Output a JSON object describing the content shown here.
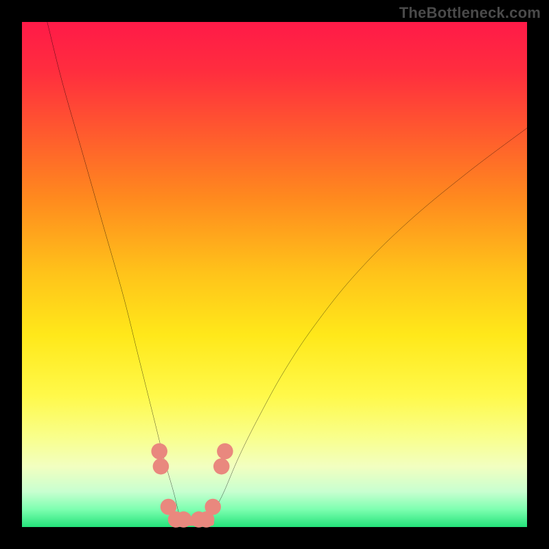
{
  "watermark": "TheBottleneck.com",
  "gradient": {
    "stops": [
      {
        "offset": 0.0,
        "color": "#ff1a48"
      },
      {
        "offset": 0.1,
        "color": "#ff2e3e"
      },
      {
        "offset": 0.22,
        "color": "#ff5a2e"
      },
      {
        "offset": 0.35,
        "color": "#ff8a1e"
      },
      {
        "offset": 0.5,
        "color": "#ffc41a"
      },
      {
        "offset": 0.62,
        "color": "#ffe81a"
      },
      {
        "offset": 0.74,
        "color": "#fff94a"
      },
      {
        "offset": 0.82,
        "color": "#f9ff8a"
      },
      {
        "offset": 0.88,
        "color": "#f2ffc0"
      },
      {
        "offset": 0.93,
        "color": "#c8ffd0"
      },
      {
        "offset": 0.965,
        "color": "#7dffb0"
      },
      {
        "offset": 1.0,
        "color": "#24e37a"
      }
    ]
  },
  "chart_data": {
    "type": "line",
    "title": "",
    "xlabel": "",
    "ylabel": "",
    "xlim": [
      0,
      100
    ],
    "ylim": [
      0,
      100
    ],
    "series": [
      {
        "name": "left-curve",
        "x": [
          5,
          8,
          12,
          16,
          20,
          23,
          26,
          28,
          30,
          31,
          32
        ],
        "y": [
          100,
          88,
          74,
          60,
          46,
          34,
          22,
          14,
          7,
          3,
          0
        ]
      },
      {
        "name": "right-curve",
        "x": [
          37,
          38,
          40,
          43,
          47,
          52,
          58,
          66,
          76,
          88,
          100
        ],
        "y": [
          0,
          3,
          7,
          14,
          22,
          31,
          40,
          50,
          60,
          70,
          79
        ]
      }
    ],
    "markers": [
      {
        "name": "left-dots",
        "x": [
          27.2,
          27.5,
          29.0,
          30.5,
          32.0
        ],
        "y": [
          15,
          12,
          4,
          1.5,
          1.5
        ],
        "color": "#e9887e",
        "r": 1.6
      },
      {
        "name": "right-dots",
        "x": [
          35.0,
          36.5,
          37.8,
          39.5,
          40.2
        ],
        "y": [
          1.5,
          1.5,
          4,
          12,
          15
        ],
        "color": "#e9887e",
        "r": 1.6
      }
    ],
    "valley_floor": {
      "x": [
        31.5,
        37.5
      ],
      "y": 0.8
    }
  }
}
